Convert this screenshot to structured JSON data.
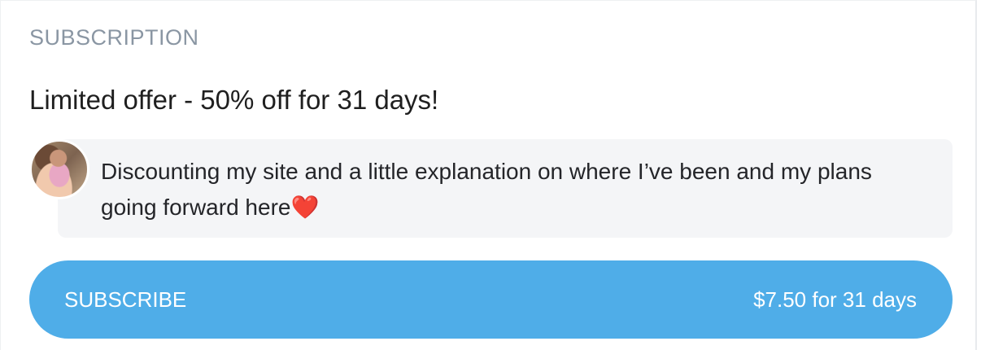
{
  "section": {
    "label": "SUBSCRIPTION"
  },
  "offer": {
    "title": "Limited offer - 50% off for 31 days!"
  },
  "message": {
    "text": "Discounting my site and a little explanation on where I’ve been and my plans going forward here",
    "emoji": "❤️"
  },
  "subscribe": {
    "label": "SUBSCRIBE",
    "price": "$7.50 for 31 days"
  },
  "colors": {
    "button": "#4fade8",
    "label": "#8a96a3",
    "bubble": "#f4f5f7"
  }
}
